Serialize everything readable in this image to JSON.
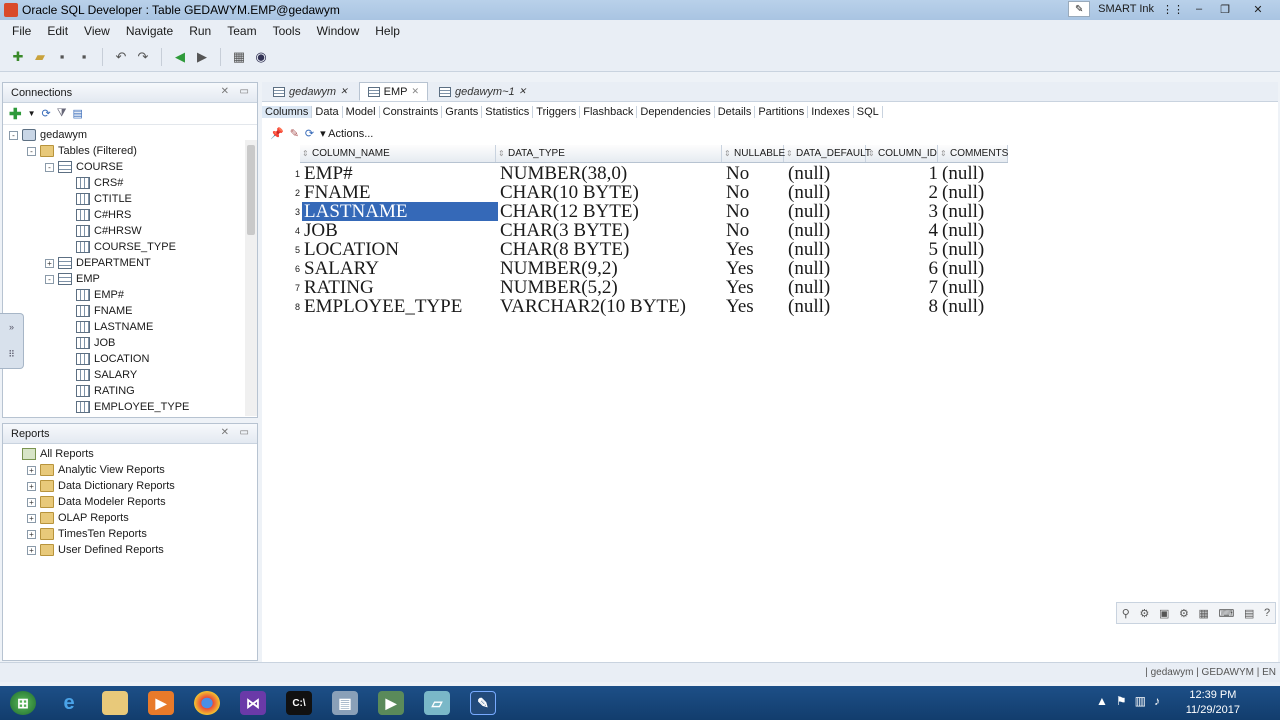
{
  "window": {
    "title": "Oracle SQL Developer : Table GEDAWYM.EMP@gedawym",
    "smart_ink": "SMART Ink"
  },
  "menu": [
    "File",
    "Edit",
    "View",
    "Navigate",
    "Run",
    "Team",
    "Tools",
    "Window",
    "Help"
  ],
  "connections": {
    "header": "Connections",
    "tree": [
      {
        "label": "gedawym",
        "level": 0,
        "icon": "db",
        "expander": "-"
      },
      {
        "label": "Tables (Filtered)",
        "level": 1,
        "icon": "folder",
        "expander": "-"
      },
      {
        "label": "COURSE",
        "level": 2,
        "icon": "table",
        "expander": "-"
      },
      {
        "label": "CRS#",
        "level": 3,
        "icon": "col",
        "expander": ""
      },
      {
        "label": "CTITLE",
        "level": 3,
        "icon": "col",
        "expander": ""
      },
      {
        "label": "C#HRS",
        "level": 3,
        "icon": "col",
        "expander": ""
      },
      {
        "label": "C#HRSW",
        "level": 3,
        "icon": "col",
        "expander": ""
      },
      {
        "label": "COURSE_TYPE",
        "level": 3,
        "icon": "col",
        "expander": ""
      },
      {
        "label": "DEPARTMENT",
        "level": 2,
        "icon": "table",
        "expander": "+"
      },
      {
        "label": "EMP",
        "level": 2,
        "icon": "table",
        "expander": "-"
      },
      {
        "label": "EMP#",
        "level": 3,
        "icon": "col",
        "expander": ""
      },
      {
        "label": "FNAME",
        "level": 3,
        "icon": "col",
        "expander": ""
      },
      {
        "label": "LASTNAME",
        "level": 3,
        "icon": "col",
        "expander": ""
      },
      {
        "label": "JOB",
        "level": 3,
        "icon": "col",
        "expander": ""
      },
      {
        "label": "LOCATION",
        "level": 3,
        "icon": "col",
        "expander": ""
      },
      {
        "label": "SALARY",
        "level": 3,
        "icon": "col",
        "expander": ""
      },
      {
        "label": "RATING",
        "level": 3,
        "icon": "col",
        "expander": ""
      },
      {
        "label": "EMPLOYEE_TYPE",
        "level": 3,
        "icon": "col",
        "expander": ""
      }
    ]
  },
  "reports": {
    "header": "Reports",
    "tree": [
      {
        "label": "All Reports",
        "level": 0,
        "icon": "rep",
        "expander": ""
      },
      {
        "label": "Analytic View Reports",
        "level": 1,
        "icon": "folder",
        "expander": "+"
      },
      {
        "label": "Data Dictionary Reports",
        "level": 1,
        "icon": "folder",
        "expander": "+"
      },
      {
        "label": "Data Modeler Reports",
        "level": 1,
        "icon": "folder",
        "expander": "+"
      },
      {
        "label": "OLAP Reports",
        "level": 1,
        "icon": "folder",
        "expander": "+"
      },
      {
        "label": "TimesTen Reports",
        "level": 1,
        "icon": "folder",
        "expander": "+"
      },
      {
        "label": "User Defined Reports",
        "level": 1,
        "icon": "folder",
        "expander": "+"
      }
    ]
  },
  "doc_tabs": [
    {
      "label": "gedawym",
      "active": false,
      "italic": true
    },
    {
      "label": "EMP",
      "active": true,
      "italic": false
    },
    {
      "label": "gedawym~1",
      "active": false,
      "italic": true
    }
  ],
  "sub_tabs": [
    "Columns",
    "Data",
    "Model",
    "Constraints",
    "Grants",
    "Statistics",
    "Triggers",
    "Flashback",
    "Dependencies",
    "Details",
    "Partitions",
    "Indexes",
    "SQL"
  ],
  "actions_label": "Actions...",
  "grid": {
    "headers": [
      "COLUMN_NAME",
      "DATA_TYPE",
      "NULLABLE",
      "DATA_DEFAULT",
      "COLUMN_ID",
      "COMMENTS"
    ],
    "rows": [
      [
        "1",
        "EMP#",
        "NUMBER(38,0)",
        "No",
        "(null)",
        "1",
        "(null)"
      ],
      [
        "2",
        "FNAME",
        "CHAR(10 BYTE)",
        "No",
        "(null)",
        "2",
        "(null)"
      ],
      [
        "3",
        "LASTNAME",
        "CHAR(12 BYTE)",
        "No",
        "(null)",
        "3",
        "(null)"
      ],
      [
        "4",
        "JOB",
        "CHAR(3 BYTE)",
        "No",
        "(null)",
        "4",
        "(null)"
      ],
      [
        "5",
        "LOCATION",
        "CHAR(8 BYTE)",
        "Yes",
        "(null)",
        "5",
        "(null)"
      ],
      [
        "6",
        "SALARY",
        "NUMBER(9,2)",
        "Yes",
        "(null)",
        "6",
        "(null)"
      ],
      [
        "7",
        "RATING",
        "NUMBER(5,2)",
        "Yes",
        "(null)",
        "7",
        "(null)"
      ],
      [
        "8",
        "EMPLOYEE_TYPE",
        "VARCHAR2(10 BYTE)",
        "Yes",
        "(null)",
        "8",
        "(null)"
      ]
    ],
    "selected_row": 3
  },
  "status": {
    "text": "| gedawym | GEDAWYM | EN"
  },
  "taskbar": {
    "clock_time": "12:39 PM",
    "clock_date": "11/29/2017"
  }
}
